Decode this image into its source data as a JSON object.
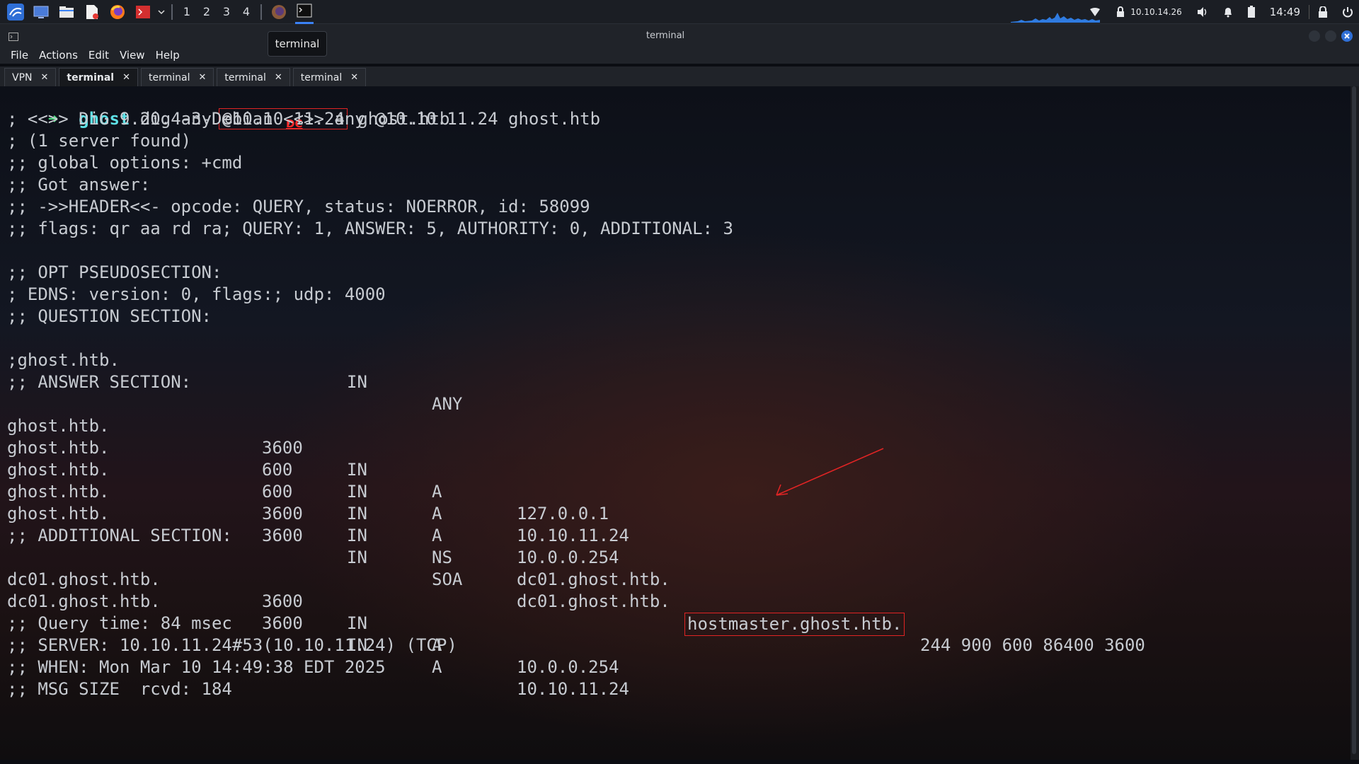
{
  "taskbar": {
    "workspaces": [
      "1",
      "2",
      "3",
      "4"
    ],
    "active_workspace": 0,
    "ip": "10.10.14.26",
    "time": "14:49"
  },
  "tooltip": "terminal",
  "window": {
    "title": "terminal",
    "menu": [
      "File",
      "Actions",
      "Edit",
      "View",
      "Help"
    ],
    "tabs": [
      {
        "label": "VPN",
        "active": false
      },
      {
        "label": "terminal",
        "active": true
      },
      {
        "label": "terminal",
        "active": false
      },
      {
        "label": "terminal",
        "active": false
      },
      {
        "label": "terminal",
        "active": false
      }
    ],
    "tab_close_glyph": "✕"
  },
  "terminal": {
    "prompt": {
      "arrow": "➜",
      "dir": "ghost",
      "cmd_pre": "dig any",
      "cmd_target": "@10.10.11.24",
      "cmd_post": "ghost.htb"
    },
    "annotation_label": "DC",
    "header_lines": [
      "; <<>> DiG 9.20.4-3-Debian <<>> any @10.10.11.24 ghost.htb",
      "; (1 server found)",
      ";; global options: +cmd",
      ";; Got answer:",
      ";; ->>HEADER<<- opcode: QUERY, status: NOERROR, id: 58099",
      ";; flags: qr aa rd ra; QUERY: 1, ANSWER: 5, AUTHORITY: 0, ADDITIONAL: 3"
    ],
    "opt_lines": [
      ";; OPT PSEUDOSECTION:",
      "; EDNS: version: 0, flags:; udp: 4000",
      ";; QUESTION SECTION:"
    ],
    "question": [
      ";ghost.htb.",
      "",
      "IN",
      "ANY",
      ""
    ],
    "answer_header": ";; ANSWER SECTION:",
    "answers": [
      [
        "ghost.htb.",
        "3600",
        "IN",
        "A",
        "127.0.0.1"
      ],
      [
        "ghost.htb.",
        "600",
        "IN",
        "A",
        "10.10.11.24"
      ],
      [
        "ghost.htb.",
        "600",
        "IN",
        "A",
        "10.0.0.254"
      ],
      [
        "ghost.htb.",
        "3600",
        "IN",
        "NS",
        "dc01.ghost.htb."
      ],
      [
        "ghost.htb.",
        "3600",
        "IN",
        "SOA",
        "dc01.ghost.htb."
      ]
    ],
    "soa_highlight": "hostmaster.ghost.htb.",
    "soa_rest": "244 900 600 86400 3600",
    "additional_header": ";; ADDITIONAL SECTION:",
    "additional": [
      [
        "dc01.ghost.htb.",
        "3600",
        "IN",
        "A",
        "10.0.0.254"
      ],
      [
        "dc01.ghost.htb.",
        "3600",
        "IN",
        "A",
        "10.10.11.24"
      ]
    ],
    "footer_lines": [
      ";; Query time: 84 msec",
      ";; SERVER: 10.10.11.24#53(10.10.11.24) (TCP)",
      ";; WHEN: Mon Mar 10 14:49:38 EDT 2025",
      ";; MSG SIZE  rcvd: 184"
    ]
  }
}
